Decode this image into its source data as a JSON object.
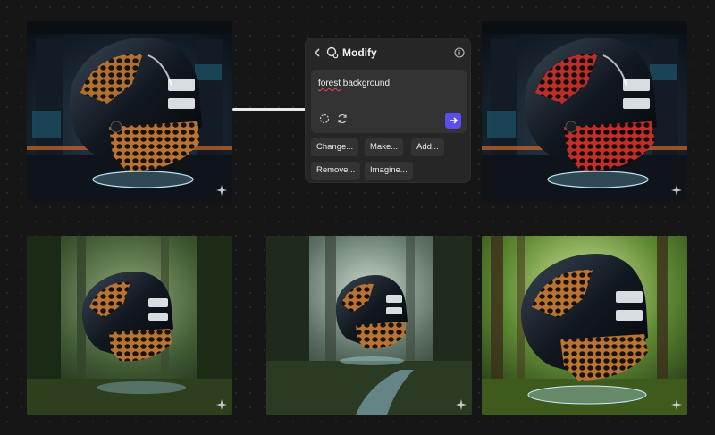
{
  "panel": {
    "title": "Modify",
    "prompt": {
      "misspelled_word": "forest",
      "rest": " background"
    },
    "chips": [
      "Change...",
      "Make...",
      "Add...",
      "Remove...",
      "Imagine..."
    ]
  },
  "icons": {
    "back": "chevron-left-icon",
    "modify": "modify-icon",
    "info": "info-icon",
    "tool1": "lasso-icon",
    "tool2": "refresh-icon",
    "send": "arrow-right-icon",
    "sparkle": "sparkle-icon"
  },
  "colors": {
    "accent": "#5b4df0",
    "helmet_original_mesh": "#c8823c",
    "helmet_modified_mesh": "#c82c24"
  }
}
